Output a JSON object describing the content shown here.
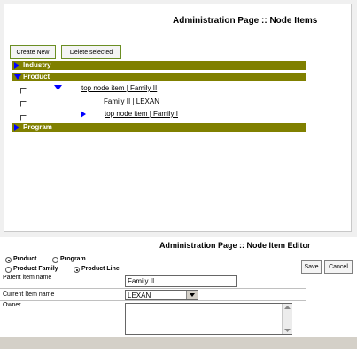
{
  "node_items": {
    "title": "Administration Page :: Node Items",
    "toolbar": {
      "create_label": "Create New",
      "delete_label": "Delete selected"
    },
    "groups": [
      {
        "label": "Industry",
        "expanded": false
      },
      {
        "label": "Product",
        "expanded": true
      },
      {
        "label": "Program",
        "expanded": false
      }
    ],
    "items": [
      {
        "label": "top node item | Family II",
        "expanded": true
      },
      {
        "label": "Family II | LEXAN"
      },
      {
        "label": "top node item | Family I",
        "expanded": false
      }
    ]
  },
  "editor": {
    "title": "Administration Page :: Node Item Editor",
    "type_options": [
      "Product",
      "Program"
    ],
    "type_selected": "Product",
    "level_options": [
      "Product Family",
      "Product Line"
    ],
    "level_selected": "Product Line",
    "save_label": "Save",
    "cancel_label": "Cancel",
    "parent_label": "Parent item name",
    "parent_value": "Family II",
    "current_label": "Current Item name",
    "current_value": "LEXAN",
    "owner_label": "Owner",
    "owner_value": ""
  },
  "colors": {
    "group_bar": "#808000",
    "arrow": "#0000ff"
  }
}
